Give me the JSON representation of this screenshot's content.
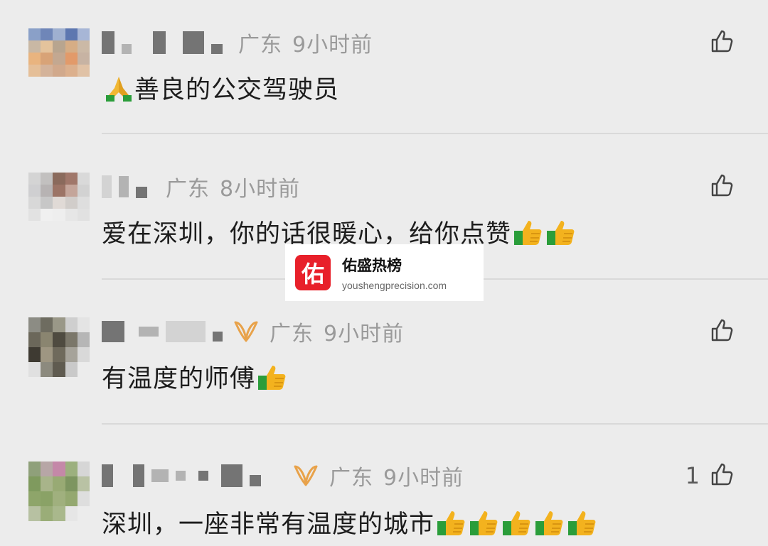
{
  "comments": [
    {
      "region": "广东",
      "time": "9小时前",
      "text": "善良的公交驾驶员",
      "emoji_before": "folded-hands",
      "emoji_after": [],
      "likes": "",
      "has_badge": false
    },
    {
      "region": "广东",
      "time": "8小时前",
      "text": "爱在深圳，你的话很暖心，给你点赞",
      "emoji_before": "",
      "emoji_after": [
        "thumbs-up",
        "thumbs-up"
      ],
      "likes": "",
      "has_badge": false
    },
    {
      "region": "广东",
      "time": "9小时前",
      "text": "有温度的师傅",
      "emoji_before": "",
      "emoji_after": [
        "thumbs-up"
      ],
      "likes": "",
      "has_badge": true
    },
    {
      "region": "广东",
      "time": "9小时前",
      "text": "深圳，一座非常有温度的城市",
      "emoji_before": "",
      "emoji_after": [
        "thumbs-up",
        "thumbs-up",
        "thumbs-up",
        "thumbs-up",
        "thumbs-up"
      ],
      "likes": "1",
      "has_badge": true
    }
  ],
  "watermark": {
    "logo_char": "佑",
    "title": "佑盛热榜",
    "url": "youshengprecision.com"
  },
  "colors": {
    "background": "#ececec",
    "meta_text": "#9a9a9a",
    "badge": "#e8a24a",
    "watermark_logo": "#e8202a"
  }
}
